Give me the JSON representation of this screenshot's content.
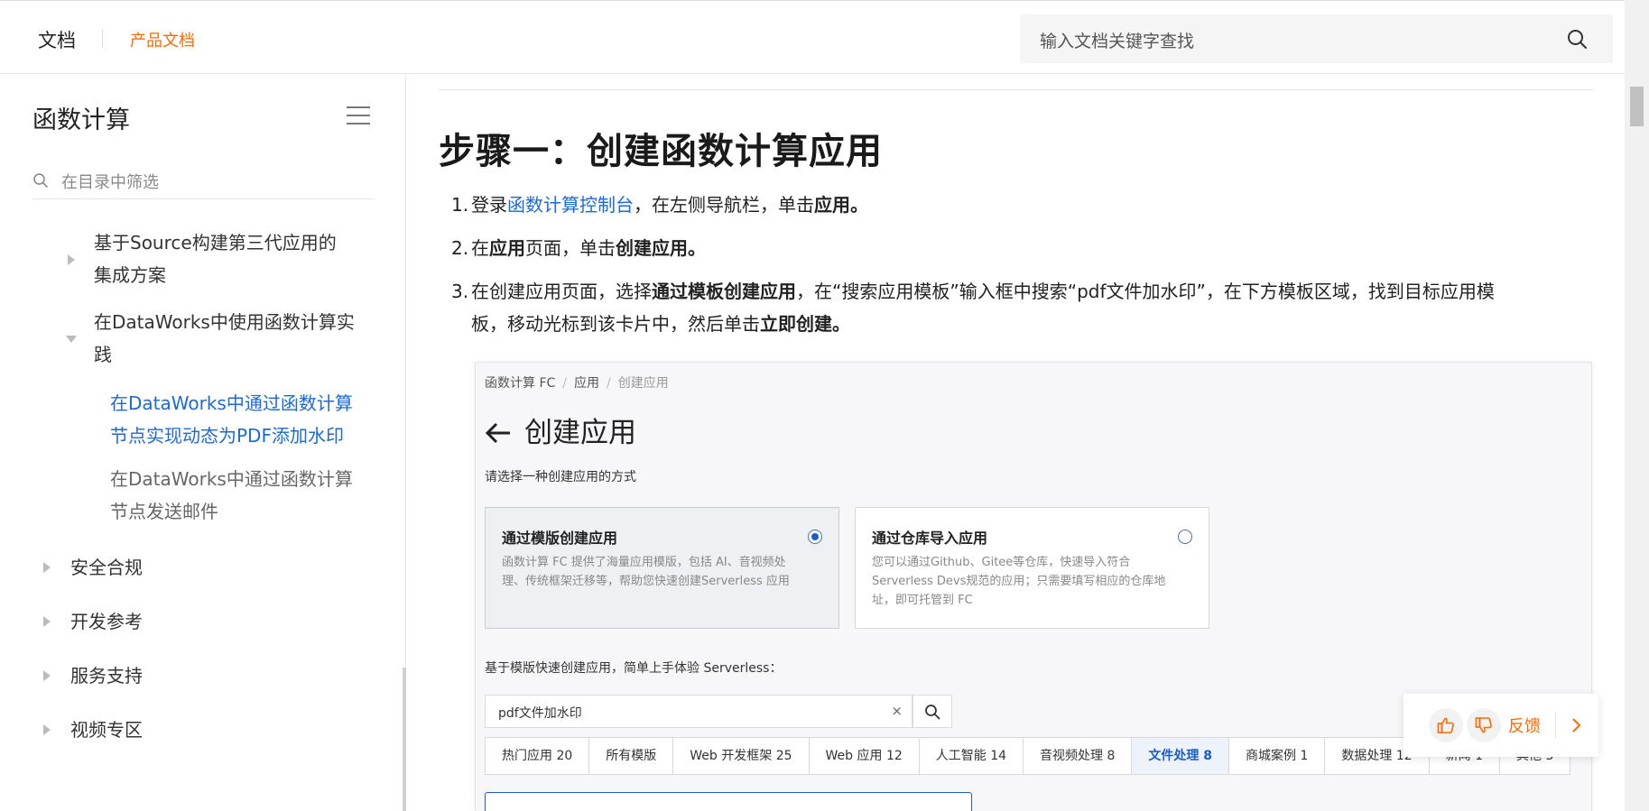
{
  "header": {
    "brand": "文档",
    "sub_brand": "产品文档",
    "search_placeholder": "输入文档关键字查找"
  },
  "sidebar": {
    "title": "函数计算",
    "filter_placeholder": "在目录中筛选",
    "items": [
      {
        "label_lines": [
          "基于Source构建第三代应用的",
          "集成方案"
        ],
        "state": "collapsed"
      },
      {
        "label_lines": [
          "在DataWorks中使用函数计算实",
          "践"
        ],
        "state": "expanded"
      },
      {
        "label_lines": [
          "在DataWorks中通过函数计算",
          "节点实现动态为PDF添加水印"
        ],
        "state": "active"
      },
      {
        "label_lines": [
          "在DataWorks中通过函数计算",
          "节点发送邮件"
        ],
        "state": "normal"
      },
      {
        "label": "安全合规"
      },
      {
        "label": "开发参考"
      },
      {
        "label": "服务支持"
      },
      {
        "label": "视频专区"
      }
    ]
  },
  "content": {
    "heading": "步骤一：创建函数计算应用",
    "step1": {
      "num": "1.",
      "p1": "登录",
      "link": "函数计算控制台",
      "p2": "，在左侧导航栏，单击",
      "b1": "应用",
      "p3": "。"
    },
    "step2": {
      "num": "2.",
      "p1": "在",
      "b1": "应用",
      "p2": "页面，单击",
      "b2": "创建应用",
      "p3": "。"
    },
    "step3": {
      "num": "3.",
      "p1": "在创建应用页面，选择",
      "b1": "通过模板创建应用",
      "p2": "，在“搜索应用模板”输入框中搜索“pdf文件加水印”，在下方模板区域，找到目标应用模",
      "p3": "板，移动光标到该卡片中，然后单击",
      "b2": "立即创建",
      "p4": "。"
    }
  },
  "screenshot": {
    "breadcrumb": [
      "函数计算 FC",
      "应用",
      "创建应用"
    ],
    "title": "创建应用",
    "subtitle": "请选择一种创建应用的方式",
    "card1": {
      "title": "通过模版创建应用",
      "desc": "函数计算 FC 提供了海量应用模版，包括 AI、音视频处理、传统框架迁移等，帮助您快速创建Serverless 应用"
    },
    "card2": {
      "title": "通过仓库导入应用",
      "desc": "您可以通过Github、Gitee等仓库，快速导入符合Serverless Devs规范的应用；只需要填写相应的仓库地址，即可托管到 FC"
    },
    "subtitle2": "基于模版快速创建应用，简单上手体验 Serverless：",
    "search_value": "pdf文件加水印",
    "clear_glyph": "×",
    "tabs": [
      "热门应用 20",
      "所有模版",
      "Web 开发框架 25",
      "Web 应用 12",
      "人工智能 14",
      "音视频处理 8",
      "文件处理 8",
      "商城案例 1",
      "数据处理 12",
      "新闻 1",
      "其他 3"
    ]
  },
  "feedback": {
    "label": "反馈"
  },
  "colors": {
    "accent": "#ff6a00",
    "link": "#1a6ad8",
    "tab_active": "#1a5cc8"
  }
}
